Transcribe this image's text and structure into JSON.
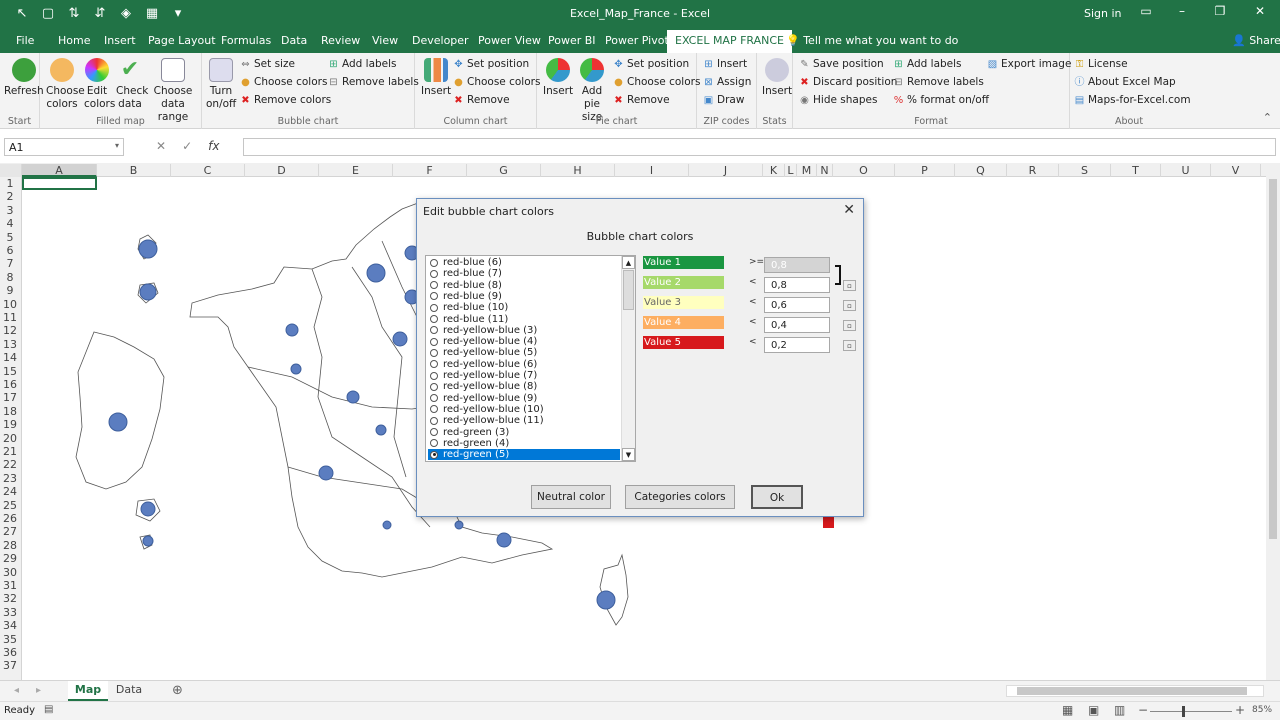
{
  "window": {
    "title": "Excel_Map_France  -  Excel",
    "sign_in": "Sign in",
    "share": "Share",
    "tell_me": "Tell me what you want to do"
  },
  "tabs": [
    "File",
    "Home",
    "Insert",
    "Page Layout",
    "Formulas",
    "Data",
    "Review",
    "View",
    "Developer",
    "Power View",
    "Power BI",
    "Power Pivot",
    "EXCEL MAP FRANCE"
  ],
  "ribbon": {
    "start": {
      "label": "Start",
      "refresh": "Refresh"
    },
    "filled_map": {
      "label": "Filled map",
      "choose_colors": "Choose colors",
      "edit_colors": "Edit colors",
      "check_data": "Check data",
      "choose_range": "Choose data range"
    },
    "bubble": {
      "label": "Bubble chart",
      "turn": "Turn on/off",
      "set_size": "Set size",
      "choose_colors": "Choose colors",
      "remove_colors": "Remove colors",
      "add_labels": "Add labels",
      "remove_labels": "Remove labels"
    },
    "column": {
      "label": "Column chart",
      "insert": "Insert",
      "set_position": "Set position",
      "choose_colors": "Choose colors",
      "remove": "Remove"
    },
    "pie": {
      "label": "Pie chart",
      "insert": "Insert",
      "add_pie": "Add pie size",
      "set_position": "Set position",
      "choose_colors": "Choose colors",
      "remove": "Remove"
    },
    "zip": {
      "label": "ZIP codes",
      "insert": "Insert",
      "assign": "Assign",
      "draw": "Draw"
    },
    "stats": {
      "label": "Stats",
      "insert": "Insert"
    },
    "format": {
      "label": "Format",
      "save_position": "Save position",
      "discard_position": "Discard position",
      "hide_shapes": "Hide shapes",
      "add_labels": "Add labels",
      "remove_labels": "Remove labels",
      "percent_format": "% format on/off",
      "export_image": "Export image"
    },
    "about": {
      "label": "About",
      "license": "License",
      "about_excel_map": "About Excel Map",
      "maps_for_excel": "Maps-for-Excel.com"
    }
  },
  "formula_bar": {
    "name_box": "A1",
    "value": ""
  },
  "columns": [
    "A",
    "B",
    "C",
    "D",
    "E",
    "F",
    "G",
    "H",
    "I",
    "J",
    "K",
    "L",
    "M",
    "N",
    "O",
    "P",
    "Q",
    "R",
    "S",
    "T",
    "U",
    "V"
  ],
  "rows": [
    "1",
    "2",
    "3",
    "4",
    "5",
    "6",
    "7",
    "8",
    "9",
    "10",
    "11",
    "12",
    "13",
    "14",
    "15",
    "16",
    "17",
    "18",
    "19",
    "20",
    "21",
    "22",
    "23",
    "24",
    "25",
    "26",
    "27",
    "28",
    "29",
    "30",
    "31",
    "32",
    "33",
    "34",
    "35",
    "36",
    "37"
  ],
  "dialog": {
    "title": "Edit bubble chart colors",
    "heading": "Bubble chart colors",
    "schemes": [
      "red-blue (6)",
      "red-blue (7)",
      "red-blue (8)",
      "red-blue (9)",
      "red-blue (10)",
      "red-blue (11)",
      "red-yellow-blue (3)",
      "red-yellow-blue (4)",
      "red-yellow-blue (5)",
      "red-yellow-blue (6)",
      "red-yellow-blue (7)",
      "red-yellow-blue (8)",
      "red-yellow-blue (9)",
      "red-yellow-blue (10)",
      "red-yellow-blue (11)",
      "red-green (3)",
      "red-green (4)",
      "red-green (5)"
    ],
    "selected_scheme": "red-green (5)",
    "values": [
      {
        "label": "Value 1",
        "color": "#1a9641",
        "op": ">=",
        "threshold": "0,8"
      },
      {
        "label": "Value 2",
        "color": "#a6d96a",
        "op": "<",
        "threshold": "0,8"
      },
      {
        "label": "Value 3",
        "color": "#ffffbf",
        "op": "<",
        "threshold": "0,6"
      },
      {
        "label": "Value 4",
        "color": "#fdae61",
        "op": "<",
        "threshold": "0,4"
      },
      {
        "label": "Value 5",
        "color": "#d7191c",
        "op": "<",
        "threshold": "0,2"
      }
    ],
    "buttons": {
      "neutral": "Neutral color",
      "categories": "Categories colors",
      "ok": "Ok"
    }
  },
  "sheets": [
    "Map",
    "Data"
  ],
  "status": {
    "ready": "Ready",
    "zoom": "85%"
  },
  "colors": {
    "excel_green": "#217346",
    "bubble": "#5b7dc0",
    "selection_blue": "#0078d7"
  }
}
